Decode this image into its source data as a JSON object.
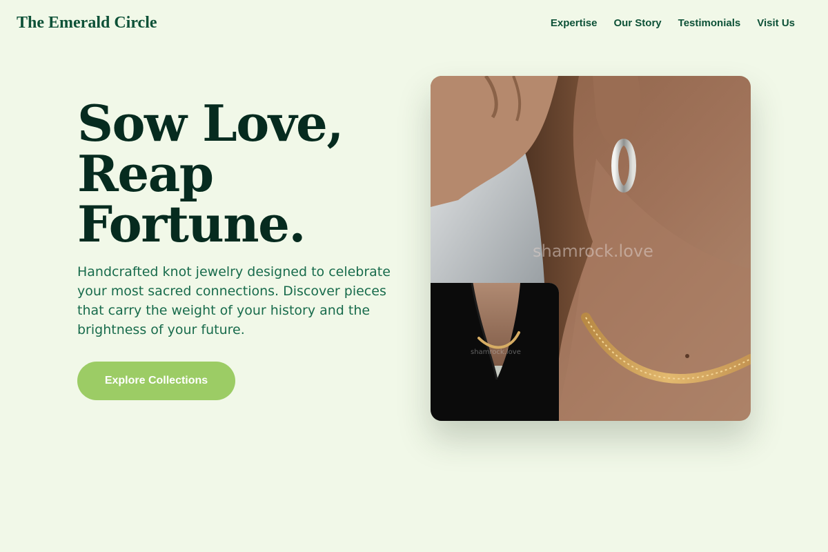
{
  "header": {
    "brand": "The Emerald Circle",
    "nav": [
      "Expertise",
      "Our Story",
      "Testimonials",
      "Visit Us"
    ]
  },
  "hero": {
    "title_lines": [
      "Sow Love,",
      "Reap",
      "Fortune."
    ],
    "description": "Handcrafted knot jewelry designed to celebrate your most sacred connections. Discover pieces that carry the weight of your history and the brightness of your future.",
    "cta_label": "Explore Collections",
    "main_image": {
      "alt": "Woman wearing silver hoop earring and gold chain necklace",
      "watermark": "shamrock.love"
    },
    "inset_image": {
      "alt": "Gold herringbone chain necklace on black top",
      "watermark": "shamrock.love"
    }
  },
  "colors": {
    "background": "#f1f8e8",
    "brand": "#0d5137",
    "title": "#062b1f",
    "body_text": "#186b4c",
    "cta": "#9ccc65"
  }
}
